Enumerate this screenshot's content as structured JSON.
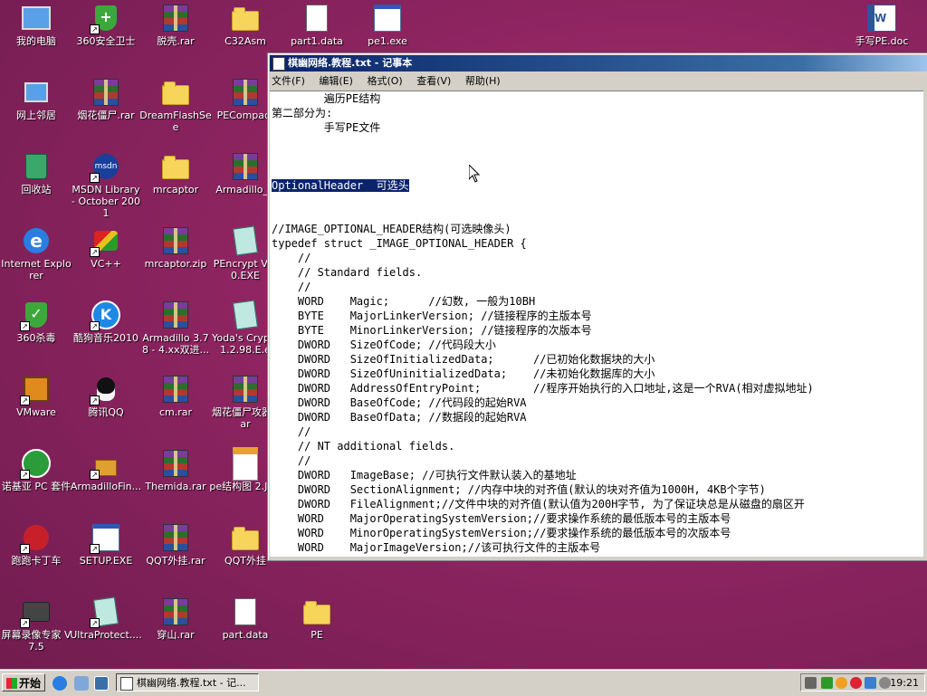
{
  "desktop": {
    "icons": [
      {
        "label": "我的电脑"
      },
      {
        "label": "360安全卫士"
      },
      {
        "label": "脱壳.rar"
      },
      {
        "label": "C32Asm"
      },
      {
        "label": "part1.data"
      },
      {
        "label": "pe1.exe"
      },
      {
        "label": "手写PE.doc"
      },
      {
        "label": "网上邻居"
      },
      {
        "label": "烟花僵尸.rar"
      },
      {
        "label": "DreamFlashSee"
      },
      {
        "label": "PECompact"
      },
      {
        "label": "回收站"
      },
      {
        "label": "MSDN Library - October 2001"
      },
      {
        "label": "mrcaptor"
      },
      {
        "label": "Armadillo_C"
      },
      {
        "label": "Internet Explorer"
      },
      {
        "label": "VC++"
      },
      {
        "label": "mrcaptor.zip"
      },
      {
        "label": "PEncrypt V4.0.EXE"
      },
      {
        "label": "360杀毒"
      },
      {
        "label": "酷狗音乐2010"
      },
      {
        "label": "Armadillo 3.78 - 4.xx双进..."
      },
      {
        "label": "Yoda's Cryp v1.2.98.E.e"
      },
      {
        "label": "VMware"
      },
      {
        "label": "腾讯QQ"
      },
      {
        "label": "cm.rar"
      },
      {
        "label": "烟花僵尸攻器.rar"
      },
      {
        "label": "诺基亚 PC 套件"
      },
      {
        "label": "ArmadilloFin..."
      },
      {
        "label": "Themida.rar"
      },
      {
        "label": "pe结构图 2.JPG"
      },
      {
        "label": "跑跑卡丁车"
      },
      {
        "label": "SETUP.EXE"
      },
      {
        "label": "QQT外挂.rar"
      },
      {
        "label": "QQT外挂"
      },
      {
        "label": "屏幕录像专家 V7.5"
      },
      {
        "label": "UltraProtect...."
      },
      {
        "label": "穿山.rar"
      },
      {
        "label": "part.data"
      },
      {
        "label": "PE"
      }
    ]
  },
  "notepad": {
    "title": "棋幽网络.教程.txt - 记事本",
    "menu": [
      "文件(F)",
      "编辑(E)",
      "格式(O)",
      "查看(V)",
      "帮助(H)"
    ],
    "lines": [
      "        遍历PE结构",
      "第二部分为:",
      "        手写PE文件",
      "",
      "",
      "",
      "OptionalHeader  可选头",
      "",
      "",
      "//IMAGE_OPTIONAL_HEADER结构(可选映像头)",
      "typedef struct _IMAGE_OPTIONAL_HEADER {",
      "    //",
      "    // Standard fields.",
      "    //",
      "    WORD    Magic;      //幻数, 一般为10BH",
      "    BYTE    MajorLinkerVersion; //链接程序的主版本号",
      "    BYTE    MinorLinkerVersion; //链接程序的次版本号",
      "    DWORD   SizeOfCode; //代码段大小",
      "    DWORD   SizeOfInitializedData;      //已初始化数据块的大小",
      "    DWORD   SizeOfUninitializedData;    //未初始化数据库的大小",
      "    DWORD   AddressOfEntryPoint;        //程序开始执行的入口地址,这是一个RVA(相对虚拟地址)",
      "    DWORD   BaseOfCode; //代码段的起始RVA",
      "    DWORD   BaseOfData; //数据段的起始RVA",
      "    //",
      "    // NT additional fields.",
      "    //",
      "    DWORD   ImageBase; //可执行文件默认装入的基地址",
      "    DWORD   SectionAlignment; //内存中块的对齐值(默认的块对齐值为1000H, 4KB个字节)",
      "    DWORD   FileAlignment;//文件中块的对齐值(默认值为200H字节, 为了保证块总是从磁盘的扇区开",
      "    WORD    MajorOperatingSystemVersion;//要求操作系统的最低版本号的主版本号",
      "    WORD    MinorOperatingSystemVersion;//要求操作系统的最低版本号的次版本号",
      "    WORD    MajorImageVersion;//该可执行文件的主版本号"
    ],
    "selected_text": "OptionalHeader  可选头"
  },
  "taskbar": {
    "start_label": "开始",
    "task_label": "棋幽网络.教程.txt - 记...",
    "clock": "19:21"
  }
}
